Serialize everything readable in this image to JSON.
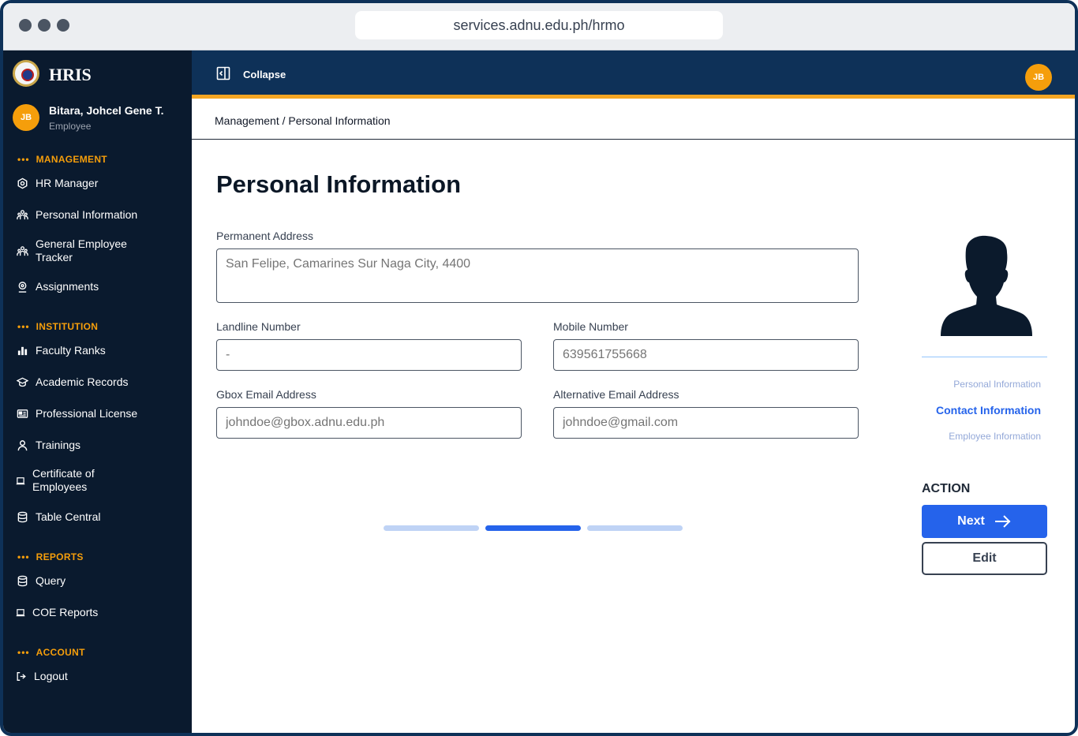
{
  "browser": {
    "url": "services.adnu.edu.ph/hrmo"
  },
  "sidebar": {
    "brand": "HRIS",
    "user": {
      "initials": "JB",
      "name": "Bitara, Johcel Gene T.",
      "role": "Employee"
    },
    "sections": [
      {
        "title": "MANAGEMENT",
        "items": [
          {
            "label": "HR Manager",
            "icon": "hexagon-gear-icon"
          },
          {
            "label": "Personal Information",
            "icon": "people-icon"
          },
          {
            "label": "General Employee Tracker",
            "icon": "people-icon"
          },
          {
            "label": "Assignments",
            "icon": "location-pin-icon"
          }
        ]
      },
      {
        "title": "INSTITUTION",
        "items": [
          {
            "label": "Faculty Ranks",
            "icon": "bar-chart-icon"
          },
          {
            "label": "Academic Records",
            "icon": "graduation-cap-icon"
          },
          {
            "label": "Professional License",
            "icon": "id-card-icon"
          },
          {
            "label": "Trainings",
            "icon": "person-icon"
          },
          {
            "label": "Certificate of Employees",
            "icon": "document-icon"
          },
          {
            "label": "Table Central",
            "icon": "database-icon"
          }
        ]
      },
      {
        "title": "REPORTS",
        "items": [
          {
            "label": "Query",
            "icon": "database-icon"
          },
          {
            "label": "COE Reports",
            "icon": "document-icon"
          }
        ]
      },
      {
        "title": "ACCOUNT",
        "items": [
          {
            "label": "Logout",
            "icon": "logout-icon"
          }
        ]
      }
    ]
  },
  "topbar": {
    "collapse_label": "Collapse",
    "user_initials": "JB"
  },
  "breadcrumb": "Management / Personal Information",
  "main": {
    "title": "Personal Information",
    "fields": {
      "permanent_address": {
        "label": "Permanent Address",
        "placeholder": "San Felipe, Camarines Sur Naga City, 4400"
      },
      "landline": {
        "label": "Landline Number",
        "placeholder": "-"
      },
      "mobile": {
        "label": "Mobile Number",
        "placeholder": "639561755668"
      },
      "gbox_email": {
        "label": "Gbox Email Address",
        "placeholder": "johndoe@gbox.adnu.edu.ph"
      },
      "alt_email": {
        "label": "Alternative Email Address",
        "placeholder": "johndoe@gmail.com"
      }
    },
    "progress": {
      "total_steps": 3,
      "current_step": 2
    }
  },
  "steps": {
    "items": [
      "Personal Information",
      "Contact Information",
      "Employee Information"
    ],
    "active_index": 1
  },
  "action": {
    "title": "ACTION",
    "next_label": "Next",
    "edit_label": "Edit"
  },
  "colors": {
    "sidebar_bg": "#0a1a2e",
    "topbar_bg": "#0e3158",
    "accent_orange": "#f5a623",
    "primary_blue": "#2563eb",
    "inactive_blue": "#bfd3f5"
  }
}
